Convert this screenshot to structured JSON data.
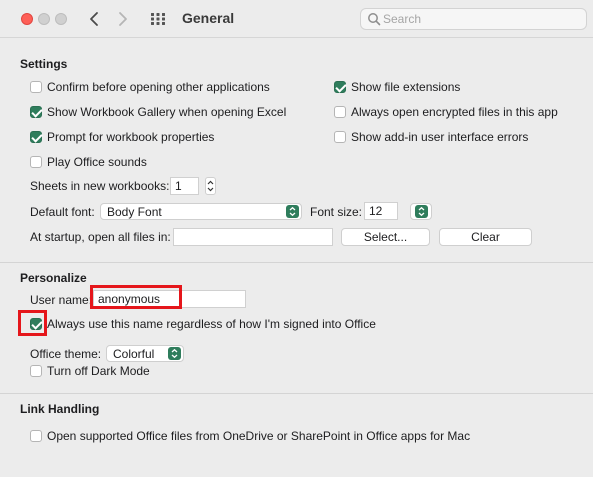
{
  "titlebar": {
    "title": "General",
    "search_placeholder": "Search"
  },
  "settings": {
    "heading": "Settings",
    "left_checkboxes": [
      {
        "label": "Confirm before opening other applications",
        "checked": false
      },
      {
        "label": "Show Workbook Gallery when opening Excel",
        "checked": true
      },
      {
        "label": "Prompt for workbook properties",
        "checked": true
      },
      {
        "label": "Play Office sounds",
        "checked": false
      }
    ],
    "right_checkboxes": [
      {
        "label": "Show file extensions",
        "checked": true
      },
      {
        "label": "Always open encrypted files in this app",
        "checked": false
      },
      {
        "label": "Show add-in user interface errors",
        "checked": false
      }
    ],
    "sheets_label": "Sheets in new workbooks:",
    "sheets_value": "1",
    "default_font_label": "Default font:",
    "default_font_value": "Body Font",
    "font_size_label": "Font size:",
    "font_size_value": "12",
    "startup_label": "At startup, open all files in:",
    "startup_value": "",
    "select_button": "Select...",
    "clear_button": "Clear"
  },
  "personalize": {
    "heading": "Personalize",
    "user_name_label": "User name:",
    "user_name_value": "anonymous",
    "always_use_label": "Always use this name regardless of how I'm signed into Office",
    "always_use_checked": true,
    "theme_label": "Office theme:",
    "theme_value": "Colorful",
    "dark_mode_label": "Turn off Dark Mode",
    "dark_mode_checked": false
  },
  "link_handling": {
    "heading": "Link Handling",
    "open_supported_label": "Open supported Office files from OneDrive or SharePoint in Office apps for Mac",
    "open_supported_checked": false
  },
  "colors": {
    "accent": "#2f7d5c",
    "highlight": "#e5161b",
    "close_button": "#fe5f57"
  },
  "icons": [
    "back-chevron-icon",
    "forward-chevron-icon",
    "grid-icon",
    "search-icon",
    "checkmark-icon",
    "popup-arrows-icon",
    "stepper-arrows-icon"
  ]
}
